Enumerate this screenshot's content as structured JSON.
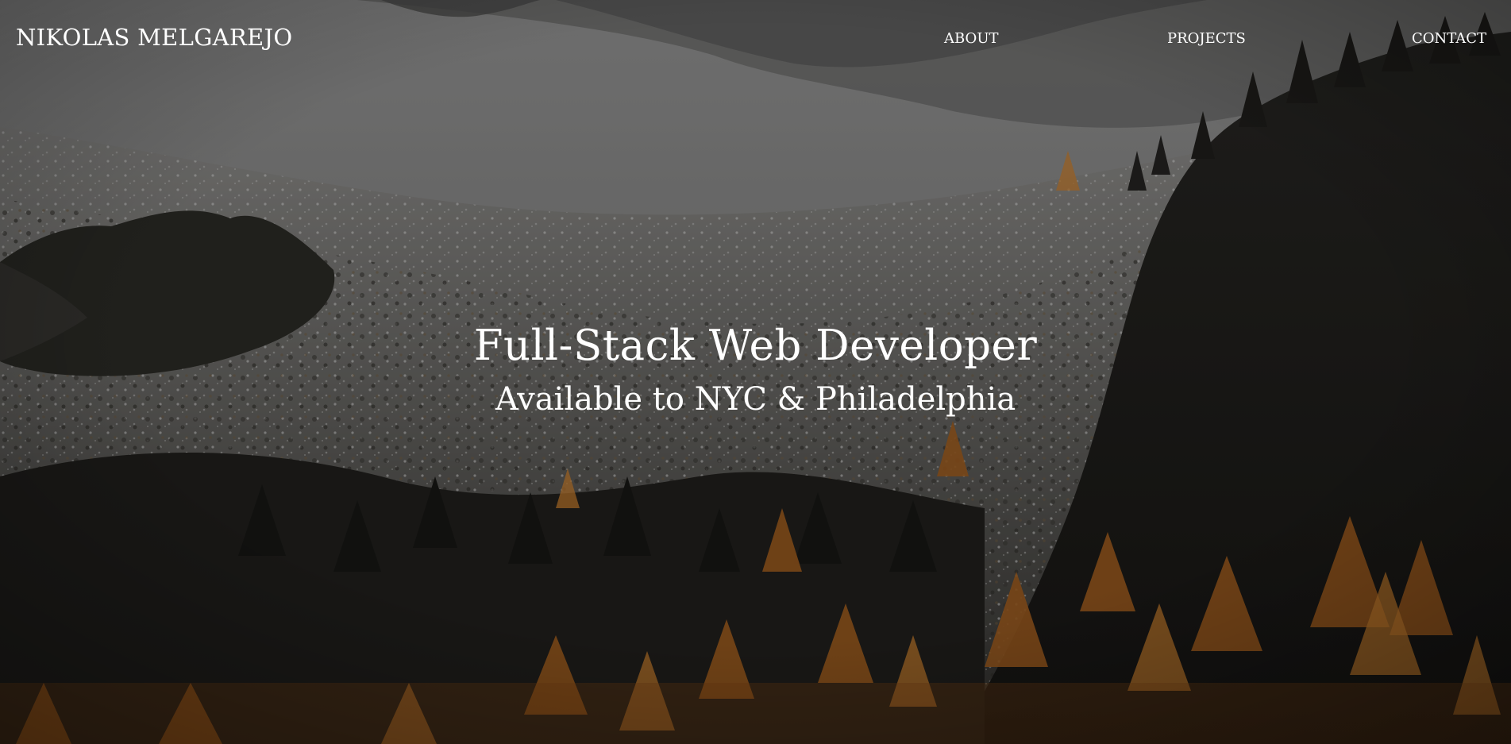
{
  "nav": {
    "brand": "NIKOLAS MELGAREJO",
    "links": [
      {
        "label": "ABOUT"
      },
      {
        "label": "PROJECTS"
      },
      {
        "label": "CONTACT"
      }
    ]
  },
  "hero": {
    "title": "Full-Stack Web Developer",
    "subtitle": "Available to NYC & Philadelphia",
    "background": "snowy-mountain-forest-photo",
    "overlay_color": "#000000",
    "text_color": "#ffffff"
  },
  "colors": {
    "snow": "#d9d9d9",
    "dark_forest": "#1c1c19",
    "autumn_larch": "#b36a22"
  }
}
